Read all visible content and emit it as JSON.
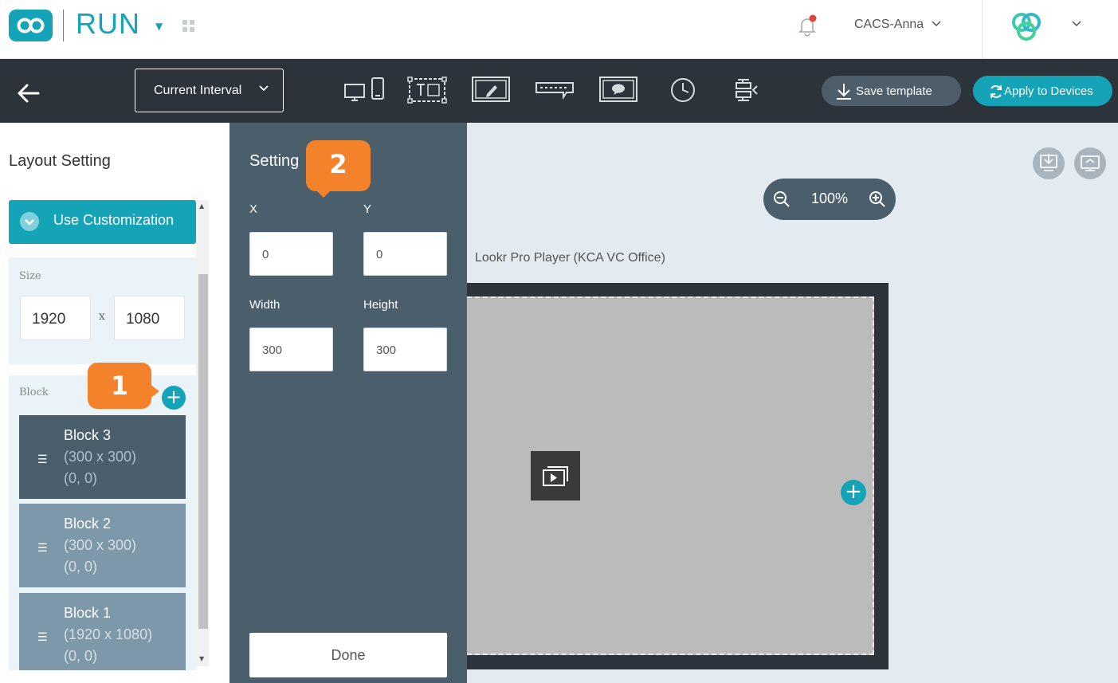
{
  "header": {
    "app_name": "RUN",
    "user_name": "CACS-Anna"
  },
  "toolbar": {
    "interval_label": "Current Interval",
    "save_template_label": "Save template",
    "apply_devices_label": "Apply to Devices",
    "tools": [
      "device-orientation-icon",
      "text-block-icon",
      "edit-block-icon",
      "ticker-icon",
      "message-icon",
      "clock-icon",
      "align-icon"
    ]
  },
  "layout": {
    "title": "Layout Setting",
    "use_customization_label": "Use Customization",
    "size_label": "Size",
    "size_width": "1920",
    "size_separator": "x",
    "size_height": "1080",
    "block_label": "Block",
    "blocks": [
      {
        "name": "Block 3",
        "size": "(300 x 300)",
        "position": "(0, 0)"
      },
      {
        "name": "Block 2",
        "size": "(300 x 300)",
        "position": "(0, 0)"
      },
      {
        "name": "Block 1",
        "size": "(1920 x 1080)",
        "position": "(0, 0)"
      }
    ]
  },
  "settings": {
    "title": "Setting",
    "x_label": "X",
    "x_value": "0",
    "y_label": "Y",
    "y_value": "0",
    "width_label": "Width",
    "width_value": "300",
    "height_label": "Height",
    "height_value": "300",
    "done_label": "Done"
  },
  "callouts": {
    "one": "1",
    "two": "2"
  },
  "canvas": {
    "zoom": "100%",
    "device_name": "Lookr Pro Player (KCA VC Office)"
  },
  "colors": {
    "accent": "#15a3b8",
    "toolbar_bg": "#2c333b",
    "settings_bg": "#4b5e6b",
    "callout": "#f4822a",
    "notification_dot": "#e0453a"
  }
}
